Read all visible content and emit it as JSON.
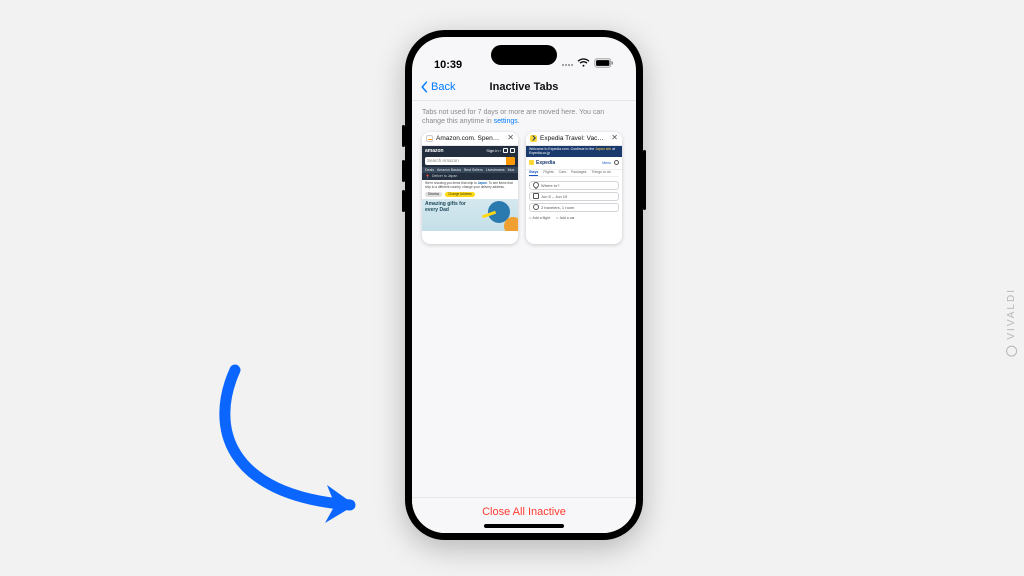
{
  "status": {
    "time": "10:39"
  },
  "nav": {
    "back": "Back",
    "title": "Inactive Tabs"
  },
  "info": {
    "text": "Tabs not used for 7 days or more are moved here. You can change this anytime in ",
    "link": "settings",
    "after": "."
  },
  "tabs": [
    {
      "title": "Amazon.com. Spen…",
      "amazon": {
        "search_placeholder": "Search Amazon",
        "nav": [
          "Deals",
          "Amazon Basics",
          "Best Sellers",
          "Livestreams",
          "Mus"
        ],
        "deliver": "Deliver to Japan",
        "notice_a": "We're showing you items that ship to ",
        "notice_b": "Japan",
        "notice_c": ". To see items that ship to a different country, change your delivery address.",
        "btn_dismiss": "Dismiss",
        "btn_change": "Change Address",
        "hero": "Amazing gifts for every Dad"
      }
    },
    {
      "title": "Expedia Travel: Vac…",
      "expedia": {
        "banner_a": "Welcome to Expedia.com. Continue to the ",
        "banner_b": "Japan site",
        "banner_c": " at Expedia.co.jp",
        "logo": "Expedia",
        "menu": "Menu",
        "tabs": [
          "Stays",
          "Flights",
          "Cars",
          "Packages",
          "Things to do"
        ],
        "where": "Where to?",
        "dates": "Jun 5 – Jun 19",
        "travelers": "2 travelers, 1 room",
        "check1": "Add a flight",
        "check2": "Add a car"
      }
    }
  ],
  "footer": {
    "close_all": "Close All Inactive"
  },
  "watermark": "VIVALDI"
}
